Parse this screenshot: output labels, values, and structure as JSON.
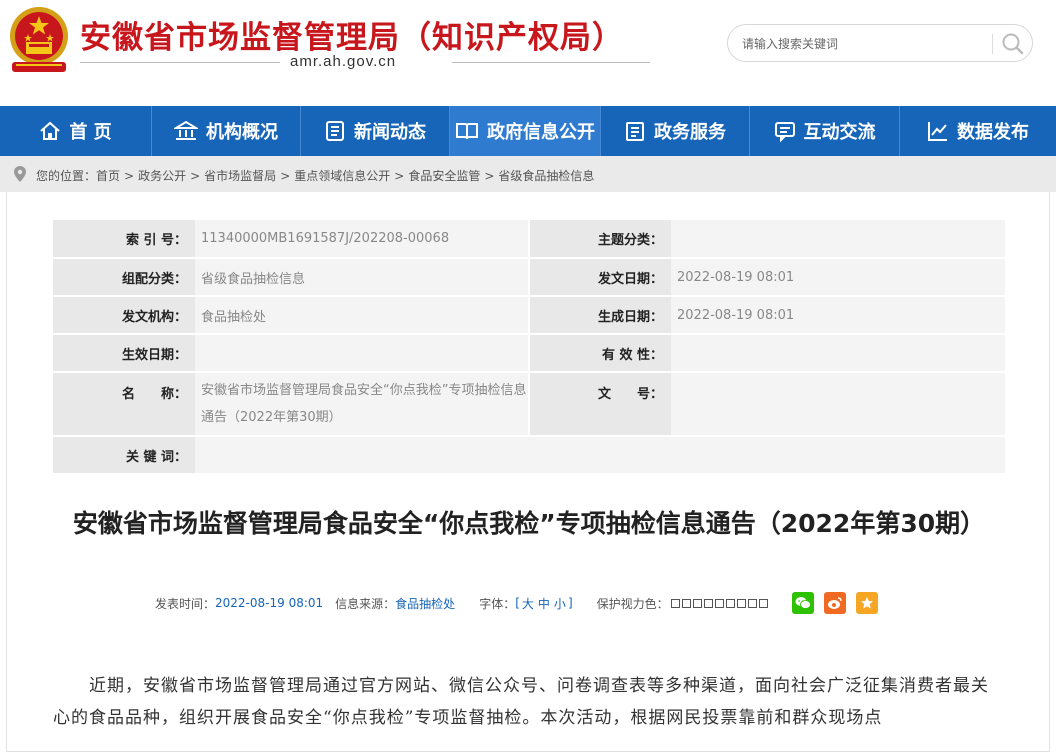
{
  "header": {
    "site_title": "安徽省市场监督管理局（知识产权局）",
    "domain": "amr.ah.gov.cn",
    "search": {
      "placeholder": "请输入搜索关键词"
    }
  },
  "colors": {
    "brand_red": "#c8161d",
    "nav_blue": "#1665b8",
    "nav_active": "#2e7bd0"
  },
  "nav": [
    {
      "label": "首 页",
      "icon": "home-icon"
    },
    {
      "label": "机构概况",
      "icon": "bank-icon"
    },
    {
      "label": "新闻动态",
      "icon": "news-icon"
    },
    {
      "label": "政府信息公开",
      "icon": "book-icon"
    },
    {
      "label": "政务服务",
      "icon": "clipboard-icon"
    },
    {
      "label": "互动交流",
      "icon": "chat-icon"
    },
    {
      "label": "数据发布",
      "icon": "chart-icon"
    }
  ],
  "breadcrumb": {
    "prefix": "您的位置：",
    "items": [
      "首页",
      "政务公开",
      "省市场监督局",
      "重点领域信息公开",
      "食品安全监管",
      "省级食品抽检信息"
    ]
  },
  "meta": {
    "index_label": "索 引 号：",
    "index_value": "11340000MB1691587J/202208-00068",
    "subject_label": "主题分类：",
    "subject_value": "",
    "group_label": "组配分类：",
    "group_value": "省级食品抽检信息",
    "pubdate_label": "发文日期：",
    "pubdate_value": "2022-08-19 08:01",
    "org_label": "发文机构：",
    "org_value": "食品抽检处",
    "gendate_label": "生成日期：",
    "gendate_value": "2022-08-19 08:01",
    "effdate_label": "生效日期：",
    "effdate_value": "",
    "valid_label": "有 效 性：",
    "valid_value": "",
    "name_label": "名　　称：",
    "name_value": "安徽省市场监督管理局食品安全“你点我检”专项抽检信息通告（2022年第30期）",
    "docno_label": "文　　号：",
    "docno_value": "",
    "keyword_label": "关 键 词：",
    "keyword_value": ""
  },
  "article": {
    "title": "安徽省市场监督管理局食品安全“你点我检”专项抽检信息通告（2022年第30期）",
    "pubtime_label": "发表时间：",
    "pubtime_value": "2022-08-19 08:01",
    "source_label": "信息来源：",
    "source_value": "食品抽检处",
    "font_label": "字体：",
    "font_open": "[",
    "font_large": "大",
    "font_medium": "中",
    "font_small": "小",
    "font_close": "]",
    "eye_label": "保护视力色：",
    "body": "近期，安徽省市场监督管理局通过官方网站、微信公众号、问卷调查表等多种渠道，面向社会广泛征集消费者最关心的食品品种，组织开展食品安全“你点我检”专项监督抽检。本次活动，根据网民投票靠前和群众现场点"
  }
}
